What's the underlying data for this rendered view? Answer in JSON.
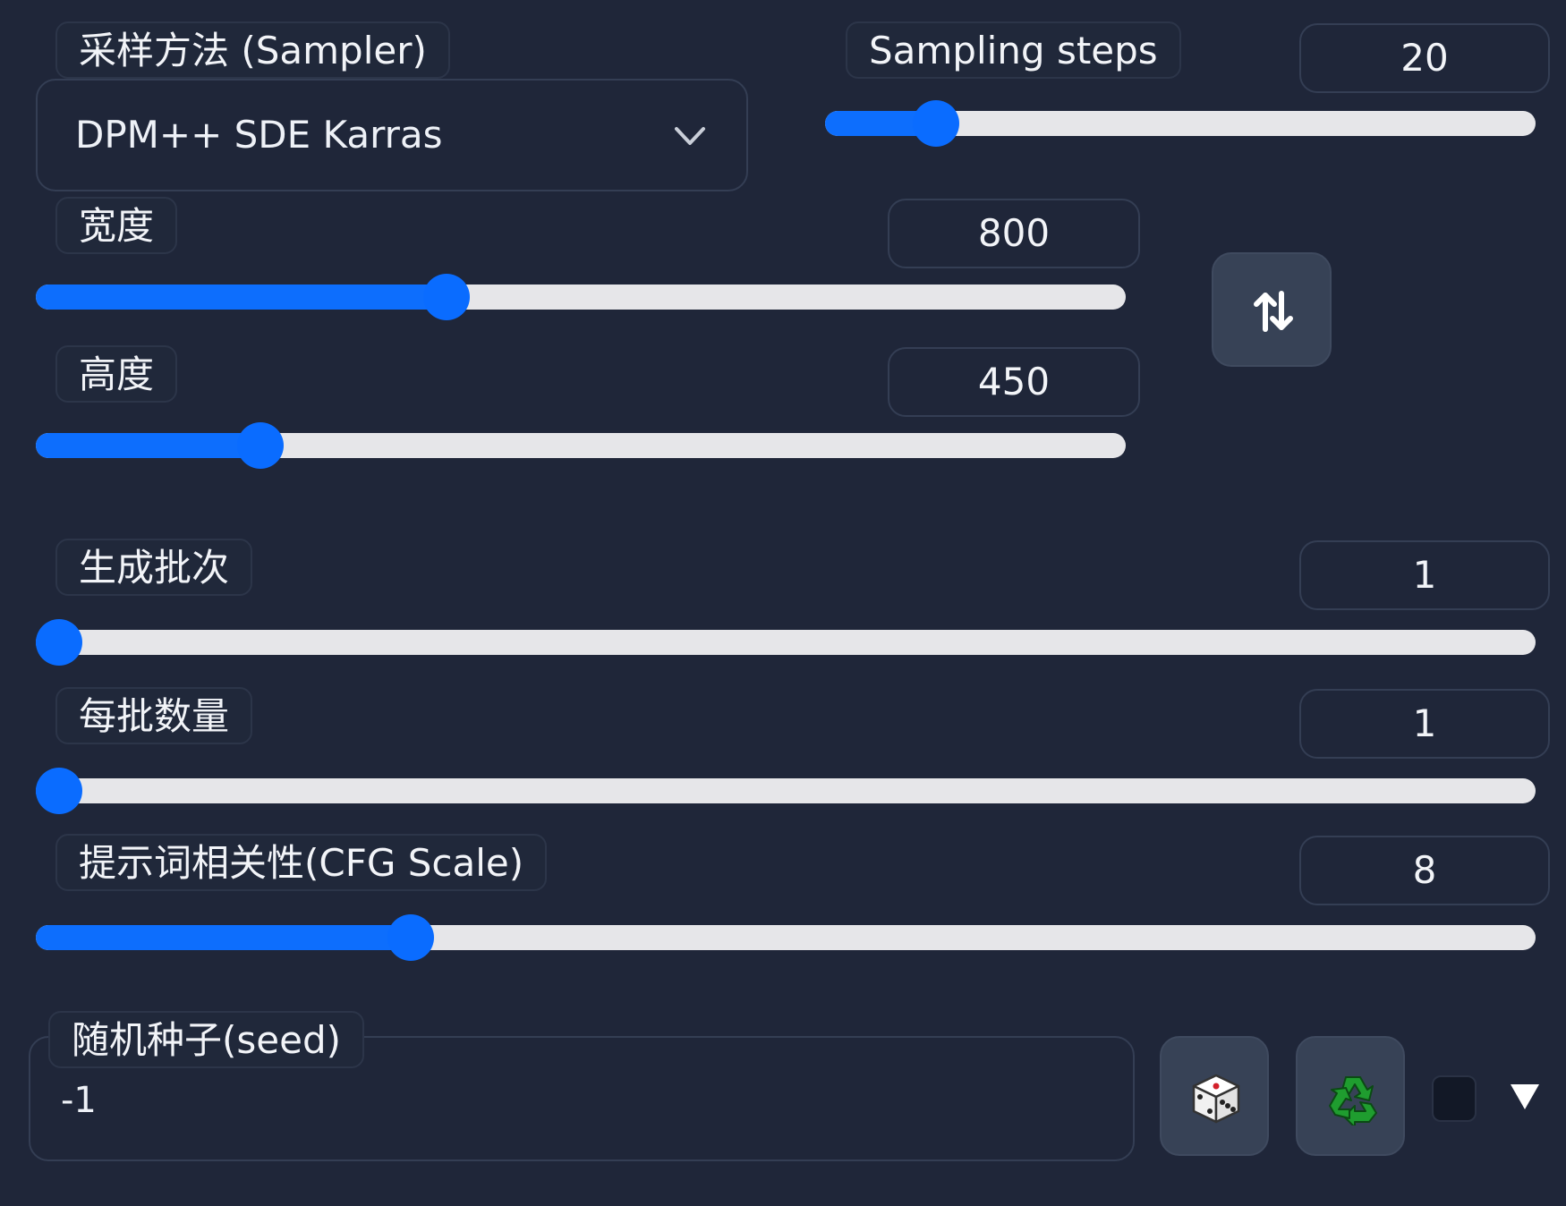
{
  "sampler": {
    "label": "采样方法 (Sampler)",
    "value": "DPM++ SDE Karras",
    "chevron_icon": "chevron-down-icon"
  },
  "sampling_steps": {
    "label": "Sampling steps",
    "value": "20",
    "fraction": 0.156
  },
  "width": {
    "label": "宽度",
    "value": "800",
    "fraction": 0.377
  },
  "height": {
    "label": "高度",
    "value": "450",
    "fraction": 0.206
  },
  "swap_button": {
    "icon": "swap-vertical-icon"
  },
  "batch_count": {
    "label": "生成批次",
    "value": "1",
    "fraction": 0.0
  },
  "batch_size": {
    "label": "每批数量",
    "value": "1",
    "fraction": 0.0
  },
  "cfg_scale": {
    "label": "提示词相关性(CFG Scale)",
    "value": "8",
    "fraction": 0.25
  },
  "seed": {
    "label": "随机种子(seed)",
    "value": "-1",
    "random_icon": "dice-icon",
    "reuse_icon": "recycle-icon",
    "expand_icon": "triangle-down-icon"
  },
  "colors": {
    "background": "#1f2639",
    "accent": "#0d6efd",
    "track": "#e6e6e9",
    "recycle": "#1f9d2f"
  }
}
